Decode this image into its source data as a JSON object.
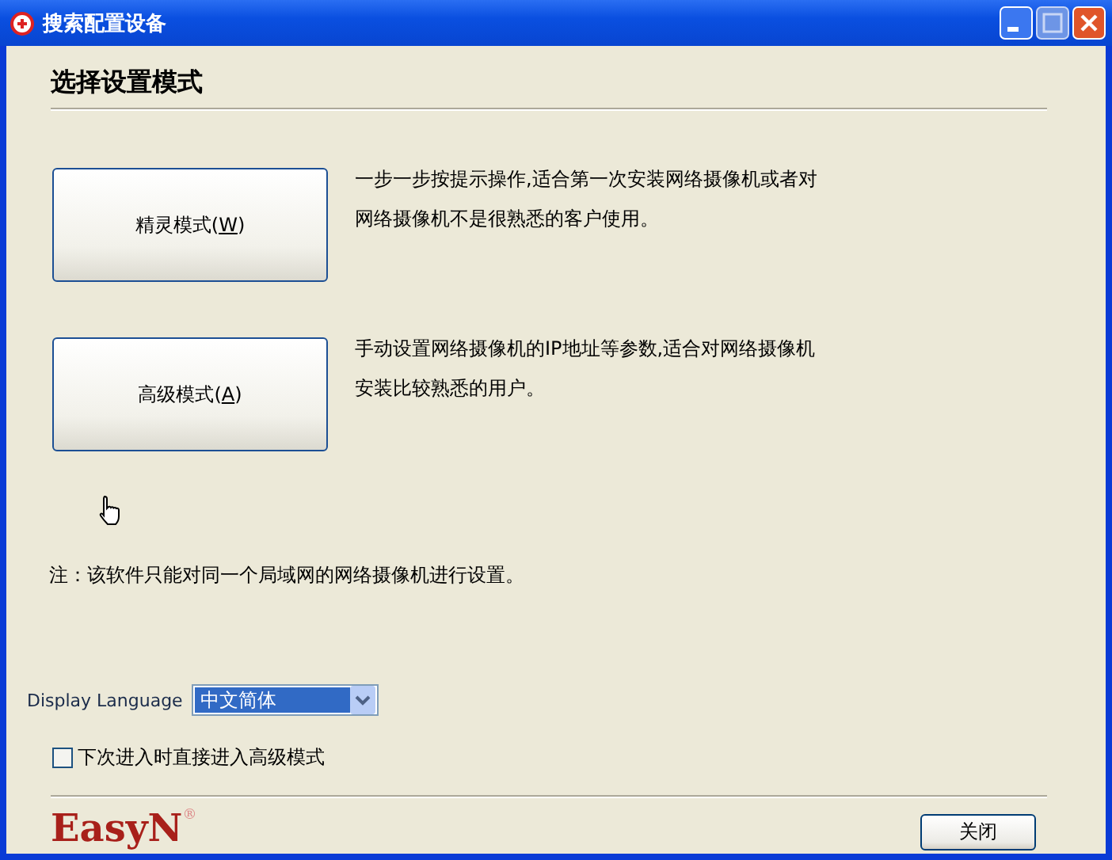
{
  "window": {
    "title": "搜索配置设备"
  },
  "heading": "选择设置模式",
  "modes": [
    {
      "label": "精灵模式(",
      "mnemonic": "W",
      "label_end": ")",
      "description": "一步一步按提示操作,适合第一次安装网络摄像机或者对网络摄像机不是很熟悉的客户使用。"
    },
    {
      "label": "高级模式(",
      "mnemonic": "A",
      "label_end": ")",
      "description": "手动设置网络摄像机的IP地址等参数,适合对网络摄像机安装比较熟悉的用户。"
    }
  ],
  "note": "注：该软件只能对同一个局域网的网络摄像机进行设置。",
  "language": {
    "label": "Display Language",
    "value": "中文简体"
  },
  "skip_option": {
    "label": "下次进入时直接进入高级模式",
    "checked": false
  },
  "logo": "EasyN$^{®}$",
  "close_button": "关闭"
}
